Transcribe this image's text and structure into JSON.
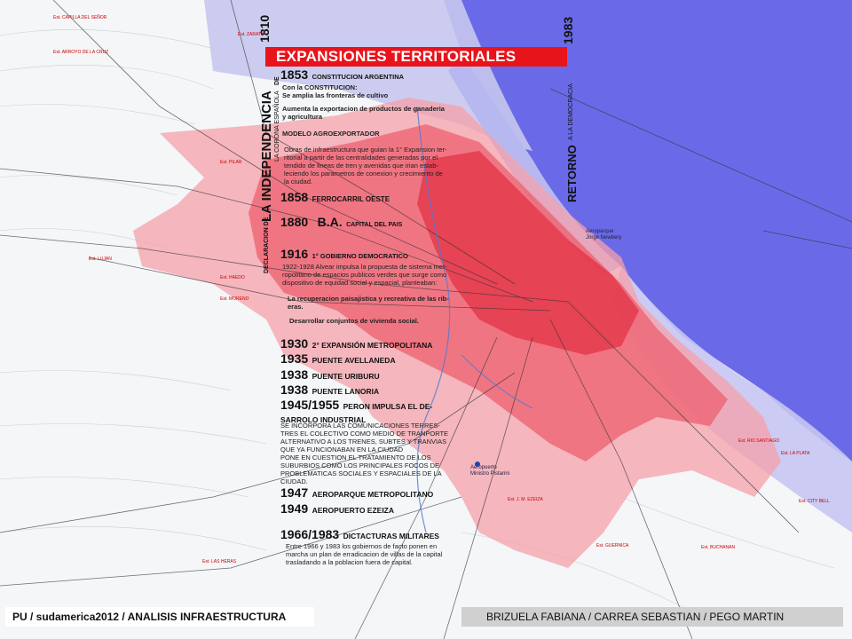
{
  "title": "EXPANSIONES TERRITORIALES",
  "years_vertical": {
    "independence_year": "1810",
    "democracy_year": "1983"
  },
  "vertical_labels": {
    "declaracion_de": "DECLARACION DE",
    "independencia": "LA INDEPENDENCIA",
    "de": "DE",
    "corona": "LA CORONA ESPAÑOLA",
    "retorno": "RETORNO",
    "democracia": "A LA DEMOCRACIA"
  },
  "timeline": {
    "t1853": {
      "year": "1853",
      "label": "CONSTITUCION ARGENTINA"
    },
    "t1853_a": "Con la CONSTITUCION:",
    "t1853_b": "Se amplia las fronteras de cultivo",
    "t1853_c": "Aumenta la exportacion de productos de ganaderia",
    "t1853_d": "y agricultura",
    "modelo": "MODELO AGROEXPORTADOR",
    "obras": [
      "Obras de infraestructura que guian la 1° Expansion ter-",
      "ritorial a partir de las centralidades generadas por el",
      "tendido de lineas de tren y avenidas que irian estab-",
      "leciendo los parametros de conexion y crecimiento de",
      "la ciudad."
    ],
    "t1858": {
      "year": "1858",
      "label": "FERROCARRIL OESTE"
    },
    "t1880": {
      "year": "1880",
      "ba": "B.A.",
      "label": "CAPITAL DEL PAIS"
    },
    "t1916": {
      "year": "1916",
      "label": "1° GOBIERNO DEMOCRATICO"
    },
    "alvear": [
      "1922-1928 Alvear impulsa la propuesta de sistema met-",
      "ropolitano de espacios publicos verdes que surge como",
      "dispositivo de equidad social y espacial, planteaban:"
    ],
    "recuperacion": [
      "La recuperacion paisajistica y recreativa de las rib-",
      "eras."
    ],
    "desarrollo": "Desarrollar conjuntos de vivienda social.",
    "t1930": {
      "year": "1930",
      "label": "2° EXPANSIÓN METROPOLITANA"
    },
    "t1935": {
      "year": "1935",
      "label": "PUENTE AVELLANEDA"
    },
    "t1938a": {
      "year": "1938",
      "label": "PUENTE URIBURU"
    },
    "t1938b": {
      "year": "1938",
      "label": "PUENTE LANORIA"
    },
    "t1945": {
      "year": "1945/1955",
      "label_a": "PERON IMPULSA EL DE-",
      "label_b": "SARROLO INDUSTRIAL"
    },
    "peron": [
      "SE INCORPORA LAS COMUNICACIONES TERRES-",
      "TRES EL COLECTIVO COMO MEDIO DE TRANPORTE",
      "ALTERNATIVO A LOS TRENES, SUBTES Y TRANVIAS",
      "QUE YA FUNCIONABAN EN LA CIUDAD",
      "PONE EN CUESTION EL TRATAMIENTO DE LOS",
      "SUBURBIOS COMO LOS PRINCIPALES FOCOS DE",
      "PROBLEMATICAS SOCIALES Y ESPACIALES DE LA",
      "CIUDAD."
    ],
    "t1947": {
      "year": "1947",
      "label": "AEROPARQUE METROPOLITANO"
    },
    "t1949": {
      "year": "1949",
      "label": "AEROPUERTO EZEIZA"
    },
    "t1966": {
      "year": "1966/1983",
      "label": "DICTACTURAS MILITARES"
    },
    "dictaduras": [
      "Entre 1966 y 1983 los gobiernos de facto ponen en",
      "marcha un plan de erradicacion de villas de la capital",
      "trasladando a la poblacion fuera de capital."
    ]
  },
  "map_labels": {
    "aeroparque": [
      "Aeroparque",
      "Jorge Newbery"
    ],
    "aeropuerto": [
      "Aeropuerto",
      "Ministro Pistarini"
    ],
    "places": [
      "Est. CAPILLA DEL SEÑOR",
      "Est. ARROYO DE LA CRUZ",
      "Est. PILAR",
      "Est. LUJAN",
      "Est. MORENO",
      "Est. HAEDO",
      "Est. LAS HERAS",
      "Est. BUCHANAN",
      "Est. GUERNICA",
      "Est. J. M. EZEIZA",
      "Est. LA PLATA",
      "Est. CITY BELL",
      "Est. RIO SANTIAGO",
      "Est. ZARATE"
    ]
  },
  "footer": {
    "left": "PU / sudamerica2012 / ANALISIS INFRAESTRUCTURA",
    "right": "BRIZUELA FABIANA / CARREA SEBASTIAN / PEGO MARTIN"
  },
  "colors": {
    "title_red": "#e8141c",
    "river_blue": "#6a6ae8",
    "urban_red": "#ee3a50",
    "map_bg": "#f4f6f8"
  }
}
